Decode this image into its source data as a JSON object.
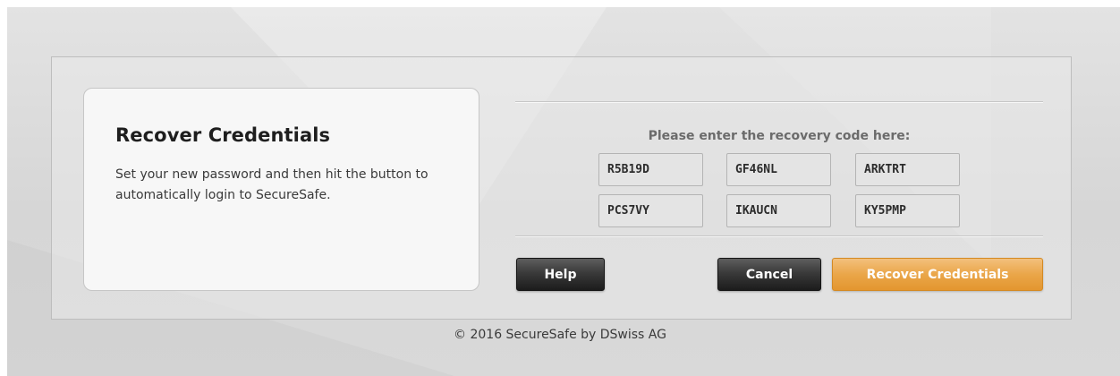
{
  "info": {
    "title": "Recover Credentials",
    "description": "Set your new password and then hit the button to automatically login to SecureSafe."
  },
  "recovery": {
    "prompt": "Please enter the recovery code here:",
    "codes": [
      "R5B19D",
      "GF46NL",
      "ARKTRT",
      "PCS7VY",
      "IKAUCN",
      "KY5PMP"
    ]
  },
  "buttons": {
    "help": "Help",
    "cancel": "Cancel",
    "recover": "Recover Credentials"
  },
  "footer": {
    "copyright": "© 2016 SecureSafe by DSwiss AG"
  },
  "colors": {
    "accent": "#e9a348",
    "dark_button": "#2b2b2b"
  }
}
